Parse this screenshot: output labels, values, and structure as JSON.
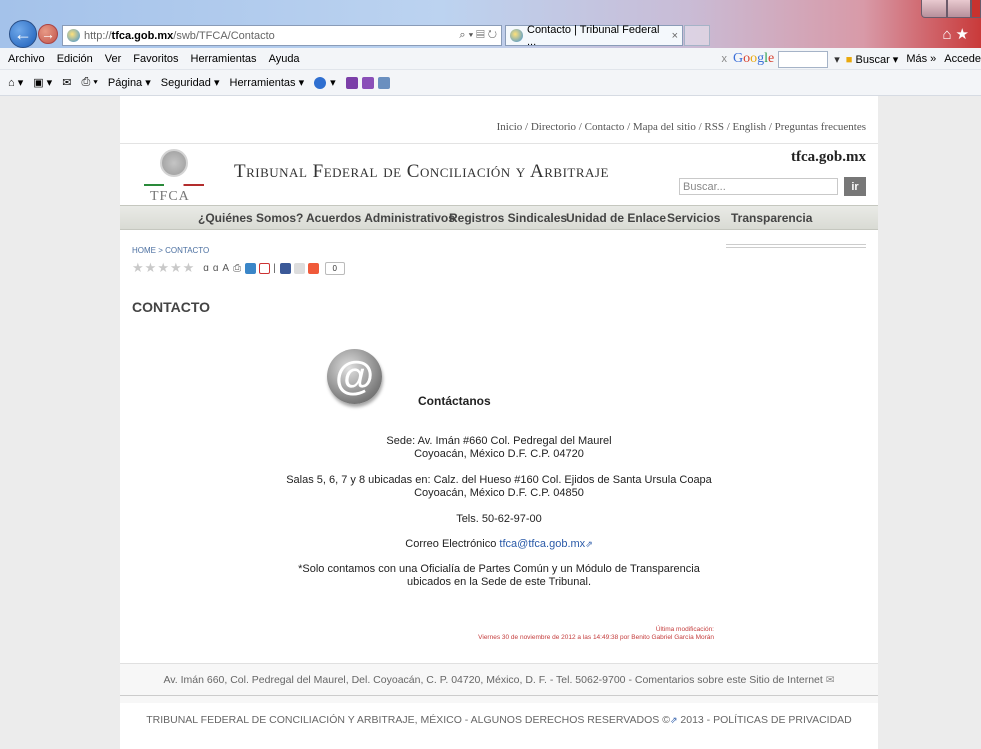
{
  "browser": {
    "address": {
      "scheme": "http://",
      "host": "tfca.gob.mx",
      "path": "/swb/TFCA/Contacto"
    },
    "tab_title": "Contacto | Tribunal Federal ...",
    "menu": [
      "Archivo",
      "Edición",
      "Ver",
      "Favoritos",
      "Herramientas",
      "Ayuda"
    ],
    "google": {
      "close": "x",
      "logo": "Google",
      "search_label": "Buscar",
      "more_label": "Más »",
      "access_label": "Accede"
    },
    "commands": [
      "Página ▾",
      "Seguridad ▾",
      "Herramientas ▾"
    ]
  },
  "site": {
    "top_links": "Inicio / Directorio / Contacto / Mapa del sitio / RSS / English / Preguntas frecuentes",
    "logo_text": "TFCA",
    "title": "Tribunal Federal de Conciliación y Arbitraje",
    "domain": "tfca.gob.mx",
    "search_placeholder": "Buscar...",
    "search_button": "ir",
    "nav": [
      "¿Quiénes Somos?",
      "Acuerdos Administrativos",
      "Registros Sindicales",
      "Unidad de Enlace",
      "Servicios",
      "Transparencia"
    ]
  },
  "content": {
    "breadcrumb": "HOME > CONTACTO",
    "share_count": "0",
    "heading": "CONTACTO",
    "contact_title": "Contáctanos",
    "sede_line1": "Sede: Av. Imán #660 Col. Pedregal del Maurel",
    "sede_line2": "Coyoacán, México D.F. C.P. 04720",
    "salas_line1": "Salas 5, 6, 7 y 8 ubicadas en: Calz. del Hueso #160 Col. Ejidos de Santa Ursula Coapa",
    "salas_line2": "Coyoacán, México D.F. C.P. 04850",
    "tels": "Tels. 50-62-97-00",
    "email_label": "Correo Electrónico",
    "email": "tfca@tfca.gob.mx",
    "note_line1": "*Solo contamos con una Oficialía de Partes Común y un Módulo de Transparencia",
    "note_line2": "ubicados en la Sede de este Tribunal.",
    "last_mod_label": "Última modificación:",
    "last_mod_text": "Viernes 30 de noviembre de 2012 a las 14:49:38 por Benito Gabriel García Morán"
  },
  "footer": {
    "address": "Av. Imán 660, Col. Pedregal del Maurel, Del. Coyoacán, C. P. 04720, México, D. F. - Tel. 5062-9700 - Comentarios sobre este Sitio de Internet",
    "rights": "TRIBUNAL FEDERAL DE CONCILIACIÓN Y ARBITRAJE, MÉXICO - ALGUNOS DERECHOS RESERVADOS ©",
    "rights_year": "2013 - POLÍTICAS DE PRIVACIDAD"
  }
}
